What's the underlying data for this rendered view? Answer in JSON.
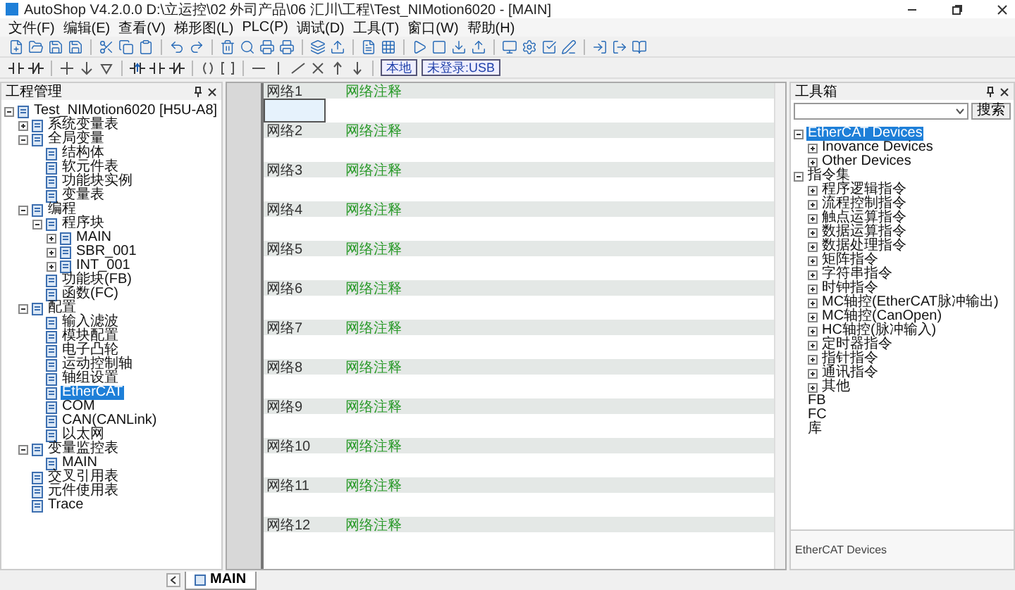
{
  "window": {
    "title": "AutoShop V4.2.0.0  D:\\立运控\\02 外司产品\\06 汇川\\工程\\Test_NIMotion6020 - [MAIN]"
  },
  "menu": [
    {
      "label": "文件(F)"
    },
    {
      "label": "编辑(E)"
    },
    {
      "label": "查看(V)"
    },
    {
      "label": "梯形图(L)"
    },
    {
      "label": "PLC(P)"
    },
    {
      "label": "调试(D)"
    },
    {
      "label": "工具(T)"
    },
    {
      "label": "窗口(W)"
    },
    {
      "label": "帮助(H)"
    }
  ],
  "toolbar": {
    "status_buttons": [
      "本地",
      "未登录:USB"
    ]
  },
  "project_panel": {
    "title": "工程管理",
    "tree": [
      {
        "label": "Test_NIMotion6020 [H5U-A8]",
        "expanded": true,
        "selected": false,
        "children": [
          {
            "label": "系统变量表",
            "expanded": false,
            "selected": false
          },
          {
            "label": "全局变量",
            "expanded": true,
            "selected": false,
            "children": [
              {
                "label": "结构体",
                "selected": false
              },
              {
                "label": "软元件表",
                "selected": false
              },
              {
                "label": "功能块实例",
                "selected": false
              },
              {
                "label": "变量表",
                "selected": false
              }
            ]
          },
          {
            "label": "编程",
            "expanded": true,
            "selected": false,
            "children": [
              {
                "label": "程序块",
                "expanded": true,
                "selected": false,
                "children": [
                  {
                    "label": "MAIN",
                    "expanded": false,
                    "selected": false
                  },
                  {
                    "label": "SBR_001",
                    "expanded": false,
                    "selected": false
                  },
                  {
                    "label": "INT_001",
                    "expanded": false,
                    "selected": false
                  }
                ]
              },
              {
                "label": "功能块(FB)",
                "selected": false
              },
              {
                "label": "函数(FC)",
                "selected": false
              }
            ]
          },
          {
            "label": "配置",
            "expanded": true,
            "selected": false,
            "children": [
              {
                "label": "输入滤波",
                "selected": false
              },
              {
                "label": "模块配置",
                "selected": false
              },
              {
                "label": "电子凸轮",
                "selected": false
              },
              {
                "label": "运动控制轴",
                "selected": false
              },
              {
                "label": "轴组设置",
                "selected": false
              },
              {
                "label": "EtherCAT",
                "selected": true
              },
              {
                "label": "COM",
                "selected": false
              },
              {
                "label": "CAN(CANLink)",
                "selected": false
              },
              {
                "label": "以太网",
                "selected": false
              }
            ]
          },
          {
            "label": "变量监控表",
            "expanded": true,
            "selected": false,
            "children": [
              {
                "label": "MAIN",
                "selected": false
              }
            ]
          },
          {
            "label": "交叉引用表",
            "selected": false
          },
          {
            "label": "元件使用表",
            "selected": false
          },
          {
            "label": "Trace",
            "selected": false
          }
        ]
      }
    ]
  },
  "editor": {
    "networks": [
      {
        "label": "网络1",
        "comment": "网络注释",
        "selected": true
      },
      {
        "label": "网络2",
        "comment": "网络注释",
        "selected": false
      },
      {
        "label": "网络3",
        "comment": "网络注释",
        "selected": false
      },
      {
        "label": "网络4",
        "comment": "网络注释",
        "selected": false
      },
      {
        "label": "网络5",
        "comment": "网络注释",
        "selected": false
      },
      {
        "label": "网络6",
        "comment": "网络注释",
        "selected": false
      },
      {
        "label": "网络7",
        "comment": "网络注释",
        "selected": false
      },
      {
        "label": "网络8",
        "comment": "网络注释",
        "selected": false
      },
      {
        "label": "网络9",
        "comment": "网络注释",
        "selected": false
      },
      {
        "label": "网络10",
        "comment": "网络注释",
        "selected": false
      },
      {
        "label": "网络11",
        "comment": "网络注释",
        "selected": false
      },
      {
        "label": "网络12",
        "comment": "网络注释",
        "selected": false
      }
    ]
  },
  "toolbox": {
    "title": "工具箱",
    "search_button": "搜索",
    "tree": [
      {
        "label": "EtherCAT Devices",
        "expanded": true,
        "selected": true,
        "children": [
          {
            "label": "Inovance Devices",
            "expanded": false,
            "selected": false
          },
          {
            "label": "Other Devices",
            "expanded": false,
            "selected": false
          }
        ]
      },
      {
        "label": "指令集",
        "expanded": true,
        "selected": false,
        "children": [
          {
            "label": "程序逻辑指令",
            "expanded": false,
            "selected": false
          },
          {
            "label": "流程控制指令",
            "expanded": false,
            "selected": false
          },
          {
            "label": "触点运算指令",
            "expanded": false,
            "selected": false
          },
          {
            "label": "数据运算指令",
            "expanded": false,
            "selected": false
          },
          {
            "label": "数据处理指令",
            "expanded": false,
            "selected": false
          },
          {
            "label": "矩阵指令",
            "expanded": false,
            "selected": false
          },
          {
            "label": "字符串指令",
            "expanded": false,
            "selected": false
          },
          {
            "label": "时钟指令",
            "expanded": false,
            "selected": false
          },
          {
            "label": "MC轴控(EtherCAT脉冲输出)",
            "expanded": false,
            "selected": false
          },
          {
            "label": "MC轴控(CanOpen)",
            "expanded": false,
            "selected": false
          },
          {
            "label": "HC轴控(脉冲输入)",
            "expanded": false,
            "selected": false
          },
          {
            "label": "定时器指令",
            "expanded": false,
            "selected": false
          },
          {
            "label": "指针指令",
            "expanded": false,
            "selected": false
          },
          {
            "label": "通讯指令",
            "expanded": false,
            "selected": false
          },
          {
            "label": "其他",
            "expanded": false,
            "selected": false
          }
        ]
      },
      {
        "label": "FB",
        "selected": false
      },
      {
        "label": "FC",
        "selected": false
      },
      {
        "label": "库",
        "selected": false
      }
    ],
    "description": "EtherCAT Devices"
  },
  "tabs": [
    {
      "label": "MAIN",
      "selected": true
    }
  ]
}
